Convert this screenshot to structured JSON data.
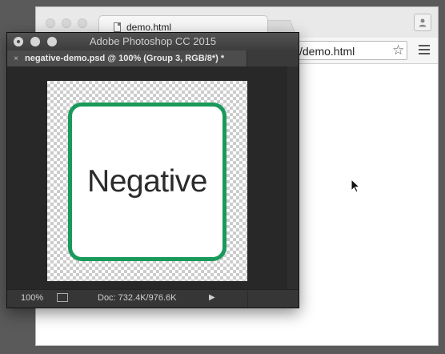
{
  "browser": {
    "tab_title": "demo.html",
    "url_visible": "/demo.html",
    "icons": {
      "tab": "file-icon",
      "bookmark": "star-icon",
      "menu": "hamburger-menu-icon",
      "profile": "profile-icon"
    }
  },
  "photoshop": {
    "window_title": "Adobe Photoshop CC 2015",
    "document_tab": "negative-demo.psd @ 100% (Group 3, RGB/8*) *",
    "tab_close": "×",
    "canvas": {
      "badge_text": "Negative",
      "badge_border_color": "#1a9a5a"
    },
    "status": {
      "zoom": "100%",
      "doc_size": "Doc: 732.4K/976.6K",
      "arrow": "▶"
    }
  }
}
